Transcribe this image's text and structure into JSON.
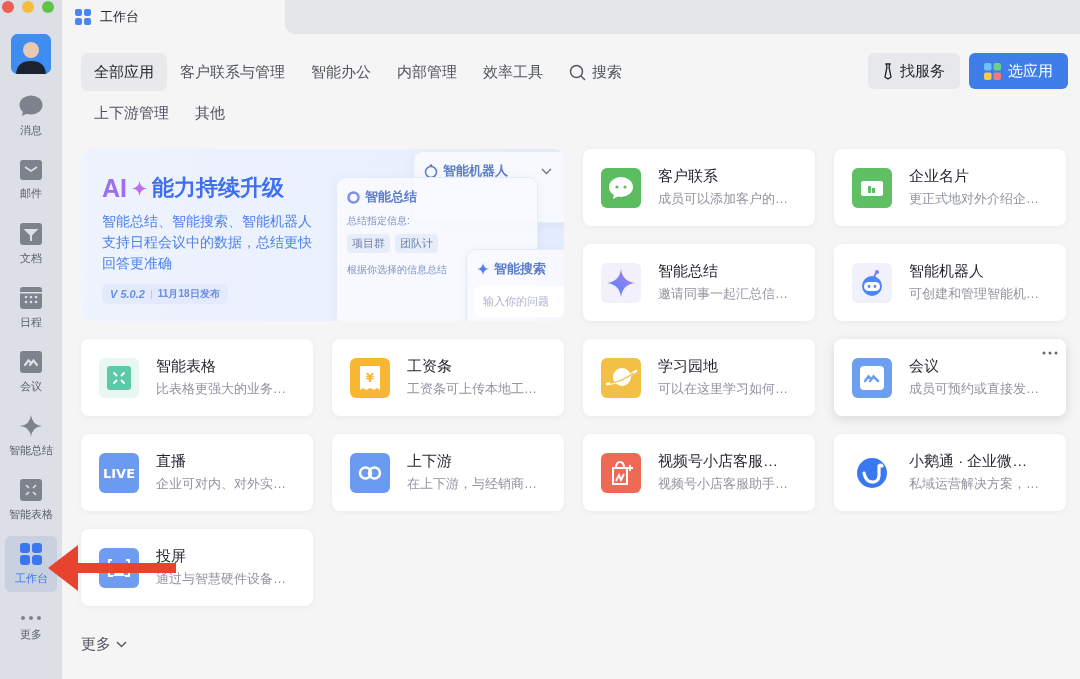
{
  "window": {
    "title": "工作台"
  },
  "sidebar": {
    "items": [
      {
        "label": "消息",
        "selected": false
      },
      {
        "label": "邮件",
        "selected": false
      },
      {
        "label": "文档",
        "selected": false
      },
      {
        "label": "日程",
        "selected": false
      },
      {
        "label": "会议",
        "selected": false
      },
      {
        "label": "智能总结",
        "selected": false
      },
      {
        "label": "智能表格",
        "selected": false
      },
      {
        "label": "工作台",
        "selected": true
      },
      {
        "label": "更多",
        "selected": false
      }
    ]
  },
  "tabs": [
    {
      "label": "全部应用",
      "selected": true,
      "kind": "tab"
    },
    {
      "label": "客户联系与管理",
      "selected": false,
      "kind": "tab"
    },
    {
      "label": "智能办公",
      "selected": false,
      "kind": "tab"
    },
    {
      "label": "内部管理",
      "selected": false,
      "kind": "tab"
    },
    {
      "label": "效率工具",
      "selected": false,
      "kind": "tab"
    },
    {
      "label": "搜索",
      "selected": false,
      "kind": "search"
    },
    {
      "label": "上下游管理",
      "selected": false,
      "kind": "tab"
    },
    {
      "label": "其他",
      "selected": false,
      "kind": "tab"
    }
  ],
  "buttons": [
    {
      "label": "找服务",
      "kind": "secondary"
    },
    {
      "label": "选应用",
      "kind": "primary"
    }
  ],
  "banner": {
    "title_prefix": "AI",
    "title": "能力持续升级",
    "description": "智能总结、智能搜索、智能机器人支持日程会议中的数据，总结更快回答更准确",
    "version": "V 5.0.2",
    "date": "11月18日发布",
    "illustration": {
      "robot_title": "智能机器人",
      "summary_title": "智能总结",
      "summary_hint": "总结指定信息:",
      "chips": [
        "项目群",
        "团队计"
      ],
      "summary_text": "根据你选择的信息总结",
      "search_title": "智能搜索",
      "search_placeholder": "输入你的问题"
    }
  },
  "apps": [
    {
      "title": "客户联系",
      "desc": "成员可以添加客户的…",
      "color": "#5cbd60",
      "hovered": false
    },
    {
      "title": "企业名片",
      "desc": "更正式地对外介绍企…",
      "color": "#5fbf63",
      "hovered": false
    },
    {
      "title": "智能总结",
      "desc": "邀请同事一起汇总信…",
      "color": "#f1f0fb",
      "hovered": false
    },
    {
      "title": "智能机器人",
      "desc": "可创建和管理智能机…",
      "color": "#f0f1fb",
      "hovered": false
    },
    {
      "title": "智能表格",
      "desc": "比表格更强大的业务…",
      "color": "#e8f7f2",
      "hovered": false
    },
    {
      "title": "工资条",
      "desc": "工资条可上传本地工…",
      "color": "#f8b733",
      "hovered": false,
      "icon_text": "¥"
    },
    {
      "title": "学习园地",
      "desc": "可以在这里学习如何…",
      "color": "#f3c047",
      "hovered": false
    },
    {
      "title": "会议",
      "desc": "成员可预约或直接发…",
      "color": "#6d9ff0",
      "hovered": true
    },
    {
      "title": "直播",
      "desc": "企业可对内、对外实…",
      "color": "#6a9bf0",
      "hovered": false,
      "icon_text": "LIVE"
    },
    {
      "title": "上下游",
      "desc": "在上下游，与经销商…",
      "color": "#6a9bf0",
      "hovered": false
    },
    {
      "title": "视频号小店客服…",
      "desc": "视频号小店客服助手…",
      "color": "#ee6a55",
      "hovered": false
    },
    {
      "title": "小鹅通 · 企业微…",
      "desc": "私域运营解决方案，…",
      "color": "#3a78f2",
      "hovered": false
    },
    {
      "title": "投屏",
      "desc": "通过与智慧硬件设备…",
      "color": "#6d9cf0",
      "hovered": false
    }
  ],
  "more": {
    "label": "更多"
  }
}
